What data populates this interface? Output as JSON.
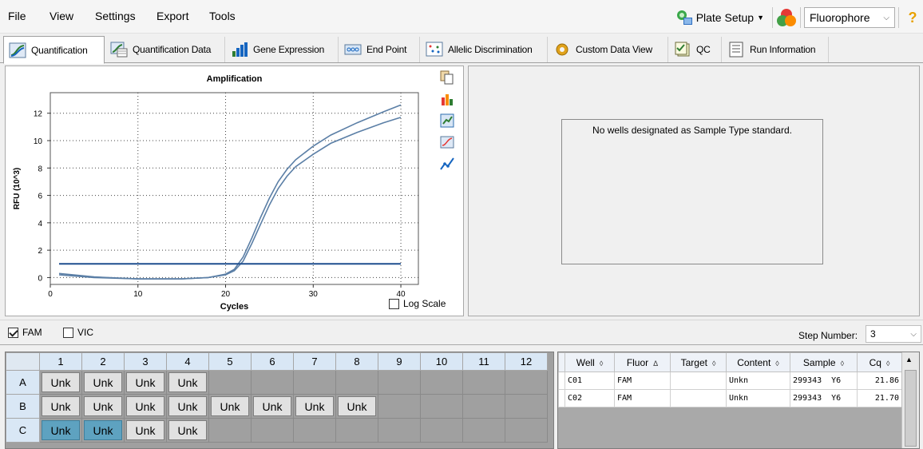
{
  "menu": {
    "items": [
      "File",
      "View",
      "Settings",
      "Export",
      "Tools"
    ]
  },
  "toolbar": {
    "plate_setup_label": "Plate Setup",
    "fluorophore_value": "Fluorophore",
    "help_label": "?"
  },
  "tabs": [
    {
      "label": "Quantification",
      "active": true
    },
    {
      "label": "Quantification Data"
    },
    {
      "label": "Gene Expression"
    },
    {
      "label": "End Point"
    },
    {
      "label": "Allelic Discrimination"
    },
    {
      "label": "Custom Data View"
    },
    {
      "label": "QC"
    },
    {
      "label": "Run Information"
    }
  ],
  "chart_data": {
    "type": "line",
    "title": "Amplification",
    "xlabel": "Cycles",
    "ylabel": "RFU (10^3)",
    "xlim": [
      0,
      42
    ],
    "ylim": [
      -0.5,
      13.5
    ],
    "xticks": [
      0,
      10,
      20,
      30,
      40
    ],
    "yticks": [
      0,
      2,
      4,
      6,
      8,
      10,
      12
    ],
    "grid": true,
    "log_scale": false,
    "threshold": 1.0,
    "series": [
      {
        "color": "#5b7fa6",
        "x": [
          1,
          5,
          10,
          15,
          18,
          20,
          21,
          22,
          23,
          24,
          25,
          26,
          27,
          28,
          30,
          32,
          35,
          38,
          40
        ],
        "y": [
          0.3,
          0.05,
          -0.1,
          -0.1,
          0.0,
          0.25,
          0.6,
          1.5,
          2.9,
          4.4,
          5.8,
          7.0,
          7.9,
          8.6,
          9.6,
          10.4,
          11.3,
          12.1,
          12.6
        ]
      },
      {
        "color": "#5b7fa6",
        "x": [
          1,
          5,
          10,
          15,
          18,
          20,
          21,
          22,
          23,
          24,
          25,
          26,
          27,
          28,
          30,
          32,
          35,
          38,
          40
        ],
        "y": [
          0.2,
          0.0,
          -0.1,
          -0.1,
          0.0,
          0.2,
          0.5,
          1.2,
          2.5,
          3.9,
          5.3,
          6.5,
          7.4,
          8.1,
          9.0,
          9.8,
          10.6,
          11.3,
          11.7
        ]
      }
    ]
  },
  "log_scale_label": "Log Scale",
  "standard_message": "No wells designated as Sample Type standard.",
  "fluors": [
    {
      "label": "FAM",
      "checked": true
    },
    {
      "label": "VIC",
      "checked": false
    }
  ],
  "step": {
    "label": "Step Number:",
    "value": "3"
  },
  "plate": {
    "columns": [
      "1",
      "2",
      "3",
      "4",
      "5",
      "6",
      "7",
      "8",
      "9",
      "10",
      "11",
      "12"
    ],
    "rows": [
      {
        "label": "A",
        "wells": [
          "Unk",
          "Unk",
          "Unk",
          "Unk",
          "",
          "",
          "",
          "",
          "",
          "",
          "",
          ""
        ],
        "selected": []
      },
      {
        "label": "B",
        "wells": [
          "Unk",
          "Unk",
          "Unk",
          "Unk",
          "Unk",
          "Unk",
          "Unk",
          "Unk",
          "",
          "",
          "",
          ""
        ],
        "selected": []
      },
      {
        "label": "C",
        "wells": [
          "Unk",
          "Unk",
          "Unk",
          "Unk",
          "",
          "",
          "",
          "",
          "",
          "",
          "",
          ""
        ],
        "selected": [
          0,
          1
        ]
      }
    ]
  },
  "results": {
    "headers": [
      "Well",
      "Fluor",
      "Target",
      "Content",
      "Sample",
      "Cq"
    ],
    "sort_marks": [
      "◊",
      "Δ",
      "◊",
      "◊",
      "◊",
      "◊"
    ],
    "rows": [
      [
        "C01",
        "FAM",
        "",
        "Unkn",
        "299343  Y6",
        "21.86"
      ],
      [
        "C02",
        "FAM",
        "",
        "Unkn",
        "299343  Y6",
        "21.70"
      ]
    ]
  },
  "colors": {
    "threshold": "#1f4f8f",
    "curve": "#5b7fa6",
    "selected_well": "#5ea2c0",
    "header_blue": "#d9e7f5"
  }
}
